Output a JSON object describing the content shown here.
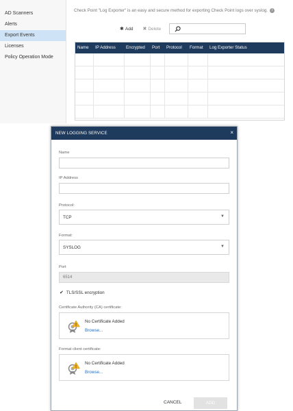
{
  "sidebar": {
    "items": [
      {
        "label": "AD Scanners"
      },
      {
        "label": "Alerts"
      },
      {
        "label": "Export Events"
      },
      {
        "label": "Licenses"
      },
      {
        "label": "Policy Operation Mode"
      }
    ]
  },
  "main": {
    "description": "Check Point \"Log Exporter\" is an easy and secure method for exporting Check Point logs over syslog.",
    "info_icon": "i",
    "toolbar": {
      "add_label": "Add",
      "delete_label": "Delete"
    },
    "search": {
      "placeholder": ""
    },
    "table": {
      "columns": [
        "Name",
        "IP Address",
        "Encrypted",
        "Port",
        "Protocol",
        "Format",
        "Log Exporter Status"
      ],
      "rows": []
    }
  },
  "modal": {
    "title": "NEW LOGGING SERVICE",
    "close_icon": "×",
    "name": {
      "label": "Name",
      "value": ""
    },
    "ip": {
      "label": "IP Address",
      "value": ""
    },
    "protocol": {
      "label": "Protocol:",
      "value": "TCP"
    },
    "format": {
      "label": "Format:",
      "value": "SYSLOG"
    },
    "port": {
      "label": "Port",
      "value": "6514"
    },
    "tls": {
      "label": "TLS/SSL encryption",
      "checked": true
    },
    "ca_cert": {
      "label": "Certificate Authority (CA) certificate:",
      "status": "No Certificate Added",
      "link": "Browse..."
    },
    "client_cert": {
      "label": "Format client certificate:",
      "status": "No Certificate Added",
      "link": "Browse..."
    },
    "cancel_label": "CANCEL",
    "add_label": "ADD"
  },
  "colors": {
    "header_bg": "#1e3a5c",
    "active_item_bg": "#cfe3f7",
    "link": "#1a6fc4",
    "warning": "#f0b323"
  }
}
